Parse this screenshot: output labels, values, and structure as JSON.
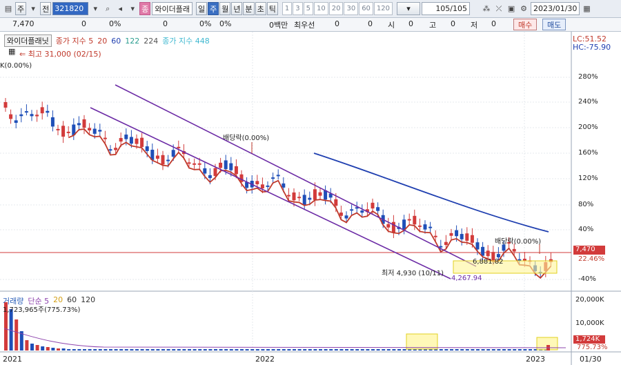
{
  "toolbar": {
    "market": "주",
    "mode": "전",
    "code": "321820",
    "stock_name": "와이더플래",
    "badge": "종",
    "periods": [
      "일",
      "주",
      "월",
      "년",
      "분",
      "초",
      "틱"
    ],
    "active_period": "주",
    "intervals": [
      "1",
      "3",
      "5",
      "10",
      "20",
      "30",
      "60",
      "120"
    ],
    "counter": "105/105",
    "date": "2023/01/30"
  },
  "pricebar": {
    "price": "7,470",
    "change": "0",
    "change_pct": "0%",
    "volume": "0",
    "volume_pct": "0%",
    "amount": "0%",
    "amount_unit": "0백만",
    "best_label": "최우선",
    "best_value": "0",
    "open_label": "시",
    "open_value": "0",
    "high_label": "고",
    "high_value": "0",
    "low_label": "저",
    "low_value": "0",
    "buy_label": "매수",
    "sell_label": "매도"
  },
  "price_panel": {
    "name_tag": "와이더플래닛",
    "legend": [
      {
        "label": "종가 지수 5",
        "color": "#c0392b"
      },
      {
        "label": "20",
        "color": "#c0392b"
      },
      {
        "label": "60",
        "color": "#1f3fb0"
      },
      {
        "label": "122",
        "color": "#2a9d8f"
      },
      {
        "label": "224",
        "color": "#555555"
      },
      {
        "label": "종가 지수 448",
        "color": "#3fb8d0"
      }
    ],
    "lc": "LC:51.52",
    "hc": "HC:-75.90",
    "high_note": "최고 31,000 (02/15)",
    "low_note": "최저 4,930 (10/11)",
    "left_pct": "K(0.00%)",
    "dividend_1": "배당락(0.00%)",
    "dividend_2": "배당락(0.00%)",
    "trend_low_label": "4,267.94",
    "channel_label": "6,881.82",
    "price_tag": "7,470",
    "price_pct_tag": "22.46%",
    "y_ticks": [
      "280%",
      "240%",
      "200%",
      "160%",
      "120%",
      "80%",
      "40%",
      "-40%"
    ],
    "price_tag_color": "#d23b3b"
  },
  "volume_panel": {
    "legend": [
      {
        "label": "거래량",
        "color": "#2b5fb8"
      },
      {
        "label": "단순 5",
        "color": "#8e44ad"
      },
      {
        "label": "20",
        "color": "#d4a017"
      },
      {
        "label": "60",
        "color": "#333333"
      },
      {
        "label": "120",
        "color": "#333333"
      }
    ],
    "volume_note": "1,723,965주(775.73%)",
    "y_ticks": [
      "20,000K",
      "10,000K"
    ],
    "vol_tag": "1,724K",
    "vol_pct_tag": "775.73%"
  },
  "x_axis": [
    "2021",
    "2022",
    "2023",
    "01/30"
  ]
}
